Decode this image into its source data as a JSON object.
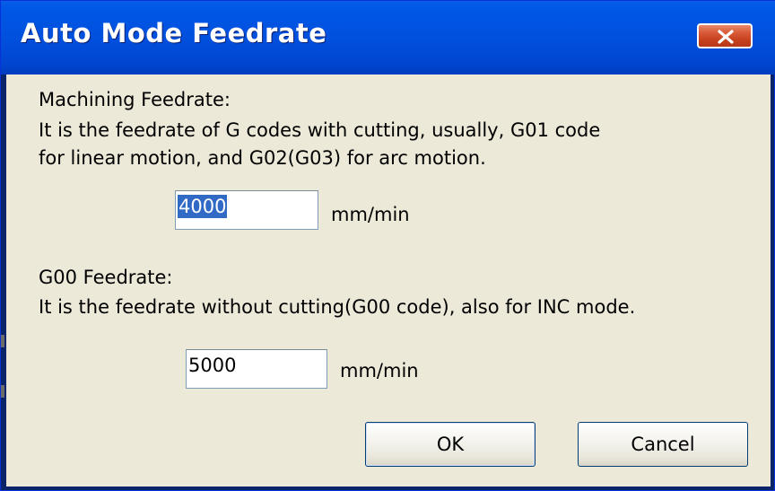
{
  "window": {
    "title": "Auto Mode Feedrate",
    "close_glyph": "✕"
  },
  "machining": {
    "heading": "Machining Feedrate:",
    "desc_line1": "It is the feedrate of G codes with cutting, usually, G01 code",
    "desc_line2": "for linear motion, and G02(G03) for arc motion.",
    "value": "4000",
    "unit": "mm/min"
  },
  "g00": {
    "heading": "G00 Feedrate:",
    "desc": "It is the feedrate without cutting(G00 code), also for INC mode.",
    "value": "5000",
    "unit": "mm/min"
  },
  "buttons": {
    "ok": "OK",
    "cancel": "Cancel"
  },
  "colors": {
    "titlebar": "#0054e3",
    "client_bg": "#ece9d8",
    "close_button": "#d6532f",
    "selection": "#316ac5"
  }
}
